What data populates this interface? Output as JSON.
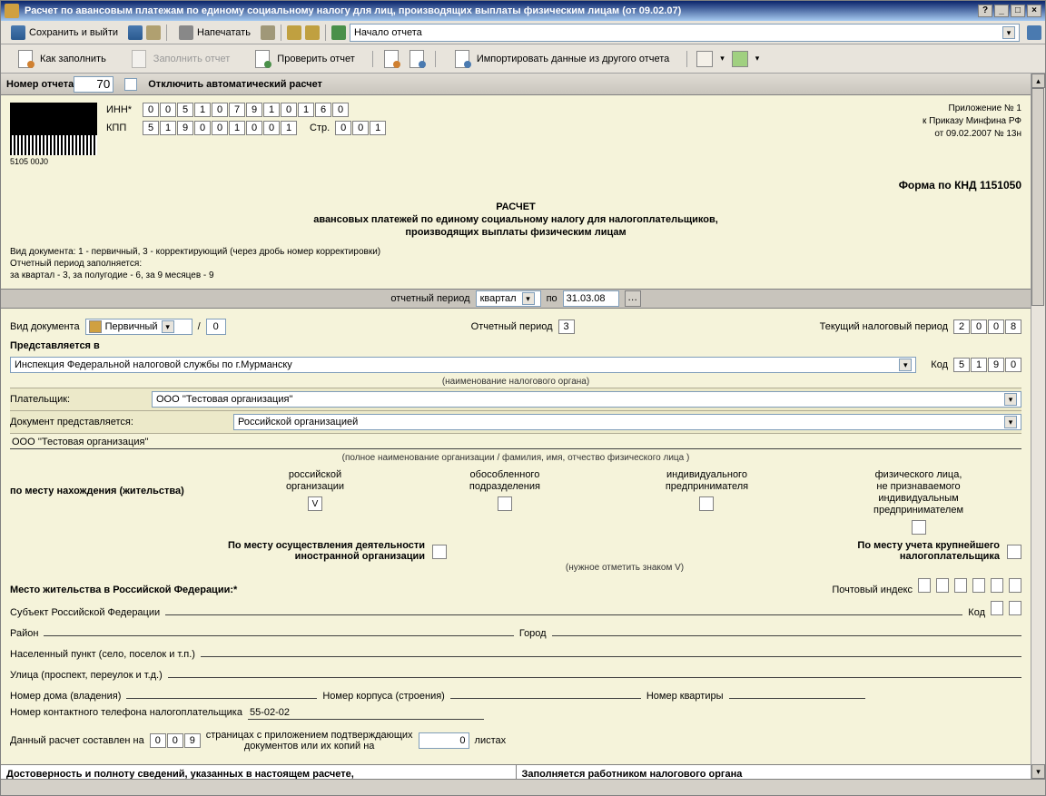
{
  "window": {
    "title": "Расчет по авансовым платежам по единому социальному налогу для лиц, производящих выплаты физическим лицам (от 09.02.07)"
  },
  "tb1": {
    "save_exit": "Сохранить и выйти",
    "print": "Напечатать",
    "nav": "Начало отчета"
  },
  "tb2": {
    "howto": "Как заполнить",
    "fill": "Заполнить отчет",
    "check": "Проверить отчет",
    "import": "Импортировать данные из другого отчета"
  },
  "hdr": {
    "num_label": "Номер отчета",
    "num": "70",
    "autocalc": "Отключить автоматический расчет"
  },
  "ids": {
    "inn_l": "ИНН*",
    "inn": [
      "0",
      "0",
      "5",
      "1",
      "0",
      "7",
      "9",
      "1",
      "0",
      "1",
      "6",
      "0"
    ],
    "kpp_l": "КПП",
    "kpp": [
      "5",
      "1",
      "9",
      "0",
      "0",
      "1",
      "0",
      "0",
      "1"
    ],
    "page_l": "Стр.",
    "page": [
      "0",
      "0",
      "1"
    ],
    "barcode": "5105 00J0"
  },
  "apx": {
    "l1": "Приложение № 1",
    "l2": "к Приказу Минфина РФ",
    "l3": "от 09.02.2007 № 13н"
  },
  "form": {
    "code": "Форма по КНД 1151050",
    "t1": "РАСЧЕТ",
    "t2": "авансовых платежей по единому социальному налогу для налогоплательщиков,",
    "t3": "производящих выплаты физическим лицам"
  },
  "hints": {
    "l1": "Вид документа: 1 - первичный, 3 - корректирующий (через дробь номер корректировки)",
    "l2": "Отчетный период заполняется:",
    "l3": "за квартал - 3, за полугодие - 6, за 9 месяцев - 9"
  },
  "period": {
    "rp_l": "отчетный период",
    "rp": "квартал",
    "po": "по",
    "date": "31.03.08"
  },
  "docrow": {
    "kind_l": "Вид документа",
    "kind": "Первичный",
    "corr": "0",
    "rp_l": "Отчетный период",
    "rp": "3",
    "tax_l": "Текущий налоговый период",
    "tax": [
      "2",
      "0",
      "0",
      "8"
    ]
  },
  "submit": {
    "to_l": "Представляется в",
    "to": "Инспекция Федеральной налоговой службы по г.Мурманску",
    "code_l": "Код",
    "code": [
      "5",
      "1",
      "9",
      "0"
    ],
    "org_sub": "(наименование налогового органа)"
  },
  "payer": {
    "l": "Плательщик:",
    "v": "ООО ''Тестовая организация''",
    "dp_l": "Документ представляется:",
    "dp": "Российской организацией",
    "full": "ООО ''Тестовая организация''",
    "full_sub": "(полное наименование организации / фамилия, имя, отчество физического лица )"
  },
  "loc": {
    "hdr": "по месту нахождения (жительства)",
    "c1": "российской\nорганизации",
    "c2": "обособленного\nподразделения",
    "c3": "индивидуального\nпредпринимателя",
    "c4": "физического лица,\nне признаваемого\nиндивидуальным\nпредпринимателем",
    "r2a": "По месту осуществления деятельности\nиностранной организации",
    "r2b": "По месту учета крупнейшего \nналогоплательщика",
    "note": "(нужное отметить знаком V)",
    "chk1": "V"
  },
  "addr": {
    "hdr": "Место жительства в Российской Федерации:*",
    "post_l": "Почтовый индекс",
    "subj": "Субъект Российской Федерации",
    "code_l": "Код",
    "raion": "Район",
    "city": "Город",
    "np": "Населенный пункт (село, поселок и т.п.)",
    "street": "Улица (проспект, переулок и т.д.)",
    "house": "Номер дома (владения)",
    "korp": "Номер корпуса (строения)",
    "flat": "Номер квартиры",
    "phone_l": "Номер контактного телефона налогоплательщика",
    "phone": "55-02-02"
  },
  "pages": {
    "p1": "Данный расчет составлен на",
    "c": [
      "0",
      "0",
      "9"
    ],
    "p2": "страницах с приложением подтверждающих\nдокументов или их копий на",
    "att": "0",
    "p3": "листах"
  },
  "footer": {
    "l": "Достоверность и полноту сведений, указанных в настоящем расчете,\nподтверждаю:",
    "r": "Заполняется работником налогового органа"
  }
}
